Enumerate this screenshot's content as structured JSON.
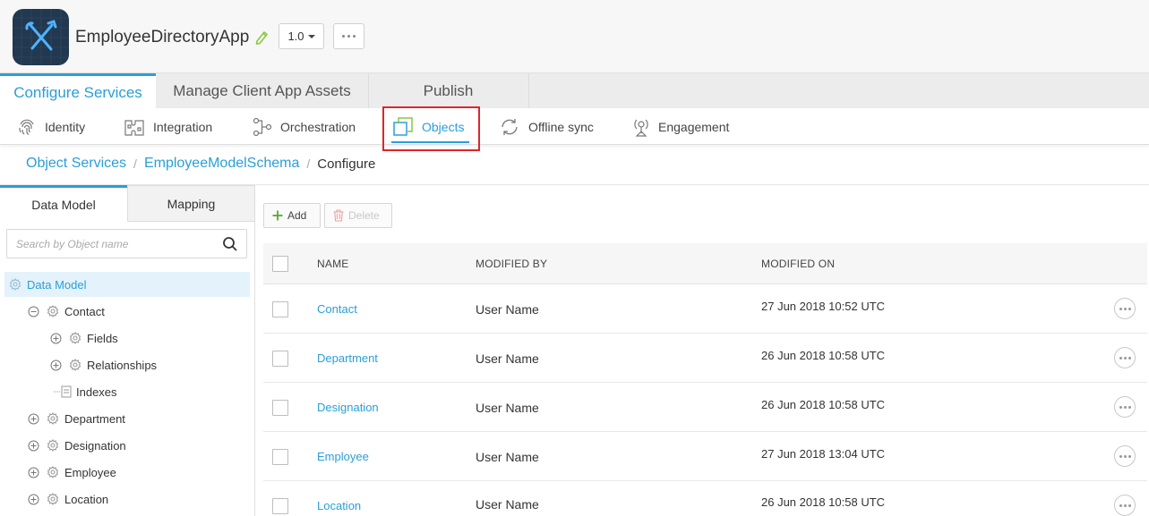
{
  "app": {
    "name": "EmployeeDirectoryApp",
    "version": "1.0"
  },
  "top_tabs": [
    {
      "label": "Configure Services",
      "active": true
    },
    {
      "label": "Manage Client App Assets",
      "active": false
    },
    {
      "label": "Publish",
      "active": false
    }
  ],
  "sub_nav": [
    {
      "label": "Identity",
      "icon": "fingerprint-icon"
    },
    {
      "label": "Integration",
      "icon": "integration-icon"
    },
    {
      "label": "Orchestration",
      "icon": "orchestration-icon"
    },
    {
      "label": "Objects",
      "icon": "objects-icon",
      "active": true
    },
    {
      "label": "Offline sync",
      "icon": "sync-icon"
    },
    {
      "label": "Engagement",
      "icon": "engagement-icon"
    }
  ],
  "breadcrumb": {
    "items": [
      "Object Services",
      "EmployeeModelSchema"
    ],
    "current": "Configure",
    "separator": "/"
  },
  "left_panel": {
    "tabs": [
      "Data Model",
      "Mapping"
    ],
    "search_placeholder": "Search by Object name",
    "tree": {
      "root": "Data Model",
      "contact": "Contact",
      "fields": "Fields",
      "relationships": "Relationships",
      "indexes": "Indexes",
      "department": "Department",
      "designation": "Designation",
      "employee": "Employee",
      "location": "Location"
    }
  },
  "toolbar": {
    "add_label": "Add",
    "delete_label": "Delete"
  },
  "table": {
    "columns": [
      "NAME",
      "MODIFIED BY",
      "MODIFIED ON"
    ],
    "rows": [
      {
        "name": "Contact",
        "modified_by": "User Name",
        "modified_on": "27 Jun 2018 10:52 UTC"
      },
      {
        "name": "Department",
        "modified_by": "User Name",
        "modified_on": "26 Jun 2018 10:58 UTC"
      },
      {
        "name": "Designation",
        "modified_by": "User Name",
        "modified_on": "26 Jun 2018 10:58 UTC"
      },
      {
        "name": "Employee",
        "modified_by": "User Name",
        "modified_on": "27 Jun 2018 13:04 UTC"
      },
      {
        "name": "Location",
        "modified_by": "User Name",
        "modified_on": "26 Jun 2018 10:58 UTC"
      }
    ]
  },
  "colors": {
    "accent": "#2a9fd6",
    "highlight": "#e0242a",
    "logo_bg": "#22384f"
  }
}
